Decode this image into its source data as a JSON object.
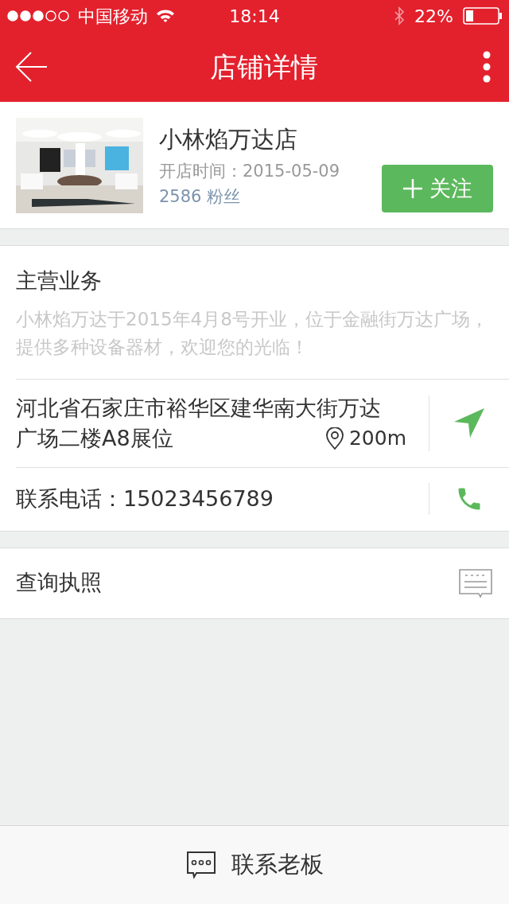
{
  "status_bar": {
    "carrier": "中国移动",
    "time": "18:14",
    "battery": "22%"
  },
  "nav": {
    "title": "店铺详情"
  },
  "store": {
    "name": "小林焰万达店",
    "opened": "开店时间：2015-05-09",
    "fans": "2586 粉丝",
    "follow_button": "关注",
    "followed": false
  },
  "business": {
    "title": "主营业务",
    "description": "小林焰万达于2015年4月8号开业，位于金融街万达广场，提供多种设备器材，欢迎您的光临！"
  },
  "address": {
    "lines": [
      "河北省石家庄市裕华区建华南大街万达",
      "广场二楼A8展位"
    ],
    "distance": "200m"
  },
  "phone": {
    "text": "联系电话：15023456789"
  },
  "license": {
    "label": "查询执照"
  },
  "bottom_bar": {
    "label": "联系老板"
  }
}
